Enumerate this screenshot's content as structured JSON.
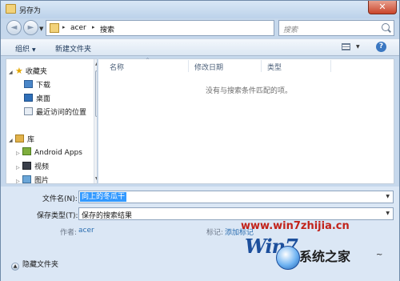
{
  "window": {
    "title": "另存为",
    "close_glyph": "✕"
  },
  "navigation": {
    "back_glyph": "◄",
    "forward_glyph": "►",
    "recent_glyph": "▼",
    "address": {
      "separator": "▸",
      "crumbs": [
        "acer",
        "搜索"
      ],
      "dropdown_glyph": "▼"
    },
    "refresh_glyph": "⟳",
    "search": {
      "placeholder": "搜索"
    }
  },
  "toolbar": {
    "organize_label": "组织",
    "new_folder_label": "新建文件夹",
    "dropdown_glyph": "▼",
    "help_glyph": "?"
  },
  "nav_pane": {
    "favorites": {
      "label": "收藏夹",
      "items": [
        {
          "label": "下载"
        },
        {
          "label": "桌面"
        },
        {
          "label": "最近访问的位置"
        }
      ]
    },
    "libraries": {
      "label": "库",
      "items": [
        {
          "label": "Android Apps"
        },
        {
          "label": "视频"
        },
        {
          "label": "图片"
        }
      ]
    },
    "expand_glyph": "▷",
    "collapse_glyph": "◢",
    "scroll_up_glyph": "▲",
    "scroll_down_glyph": "▼"
  },
  "file_list": {
    "columns": [
      "名称",
      "修改日期",
      "类型"
    ],
    "sort_glyph": "^",
    "empty_message": "没有与搜索条件匹配的项。"
  },
  "form": {
    "filename_label": "文件名(N):",
    "filename_value": "向上的冬瓜干",
    "filetype_label": "保存类型(T):",
    "filetype_value": "保存的搜索结果",
    "author_label": "作者:",
    "author_value": "acer",
    "tags_label": "标记:",
    "tags_value": "添加标记",
    "hide_folders_label": "隐藏文件夹",
    "dropdown_glyph": "▼"
  },
  "watermark": {
    "url": "www.win7zhijia.cn",
    "logo_text": "Win7",
    "brand_text": "系统之家",
    "suffix_text": "~"
  }
}
